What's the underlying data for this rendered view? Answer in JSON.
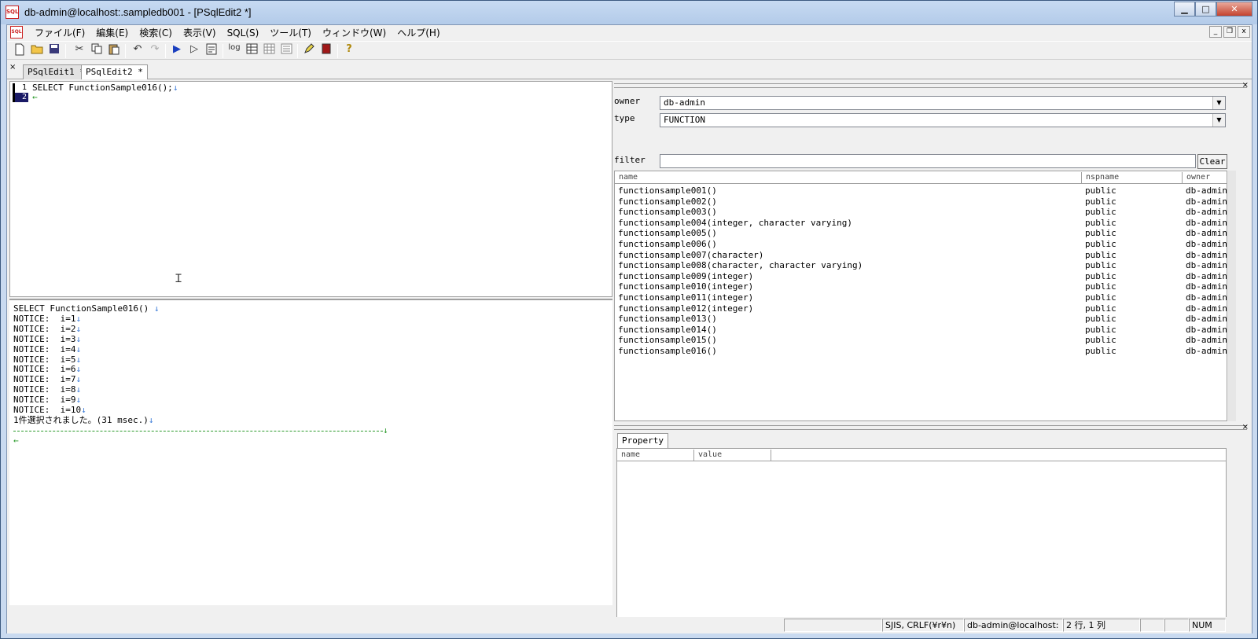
{
  "window": {
    "title": "db-admin@localhost:.sampledb001 - [PSqlEdit2 *]",
    "app_icon_label": "SQL",
    "minimize": "▁",
    "maximize": "□",
    "close": "✕"
  },
  "menu": {
    "items": [
      "ファイル(F)",
      "編集(E)",
      "検索(C)",
      "表示(V)",
      "SQL(S)",
      "ツール(T)",
      "ウィンドウ(W)",
      "ヘルプ(H)"
    ],
    "mdi_minimize": "_",
    "mdi_restore": "❐",
    "mdi_close": "x"
  },
  "toolbar": {
    "log_label": "log"
  },
  "tabs": {
    "close": "×",
    "items": [
      "PSqlEdit1 *",
      "PSqlEdit2 *"
    ]
  },
  "editor": {
    "line_numbers": [
      "1",
      "2"
    ],
    "lines": [
      "SELECT FunctionSample016();",
      ""
    ],
    "eol_marker": "↓",
    "eof_marker": "←"
  },
  "output": {
    "lines": [
      "SELECT FunctionSample016() ",
      "NOTICE:  i=1",
      "NOTICE:  i=2",
      "NOTICE:  i=3",
      "NOTICE:  i=4",
      "NOTICE:  i=5",
      "NOTICE:  i=6",
      "NOTICE:  i=7",
      "NOTICE:  i=8",
      "NOTICE:  i=9",
      "NOTICE:  i=10",
      "1件選択されました。(31 msec.)"
    ],
    "eol_marker": "↓",
    "eof_marker": "←"
  },
  "object_browser": {
    "owner_label": "owner",
    "owner_value": "db-admin",
    "type_label": "type",
    "type_value": "FUNCTION",
    "filter_label": "filter",
    "filter_value": "",
    "clear_button": "Clear",
    "columns": [
      "name",
      "nspname",
      "owner"
    ],
    "rows": [
      [
        "functionsample001()",
        "public",
        "db-admin"
      ],
      [
        "functionsample002()",
        "public",
        "db-admin"
      ],
      [
        "functionsample003()",
        "public",
        "db-admin"
      ],
      [
        "functionsample004(integer, character varying)",
        "public",
        "db-admin"
      ],
      [
        "functionsample005()",
        "public",
        "db-admin"
      ],
      [
        "functionsample006()",
        "public",
        "db-admin"
      ],
      [
        "functionsample007(character)",
        "public",
        "db-admin"
      ],
      [
        "functionsample008(character, character varying)",
        "public",
        "db-admin"
      ],
      [
        "functionsample009(integer)",
        "public",
        "db-admin"
      ],
      [
        "functionsample010(integer)",
        "public",
        "db-admin"
      ],
      [
        "functionsample011(integer)",
        "public",
        "db-admin"
      ],
      [
        "functionsample012(integer)",
        "public",
        "db-admin"
      ],
      [
        "functionsample013()",
        "public",
        "db-admin"
      ],
      [
        "functionsample014()",
        "public",
        "db-admin"
      ],
      [
        "functionsample015()",
        "public",
        "db-admin"
      ],
      [
        "functionsample016()",
        "public",
        "db-admin"
      ]
    ],
    "scroll_grip": "|||"
  },
  "property": {
    "tab_label": "Property",
    "columns": [
      "name",
      "value"
    ]
  },
  "status": {
    "encoding": "SJIS, CRLF(¥r¥n)",
    "connection": "db-admin@localhost:",
    "position": "2 行, 1 列",
    "num": "NUM"
  }
}
